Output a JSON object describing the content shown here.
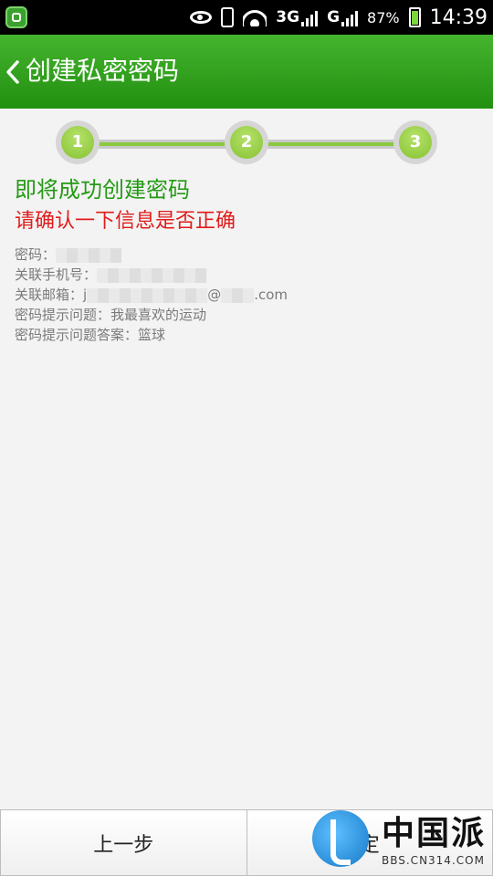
{
  "status_bar": {
    "network_3g": "3G",
    "network_g": "G",
    "battery_percent": "87%",
    "time": "14:39"
  },
  "header": {
    "title": "创建私密密码"
  },
  "stepper": {
    "steps": [
      "1",
      "2",
      "3"
    ],
    "active_color": "#8cc93f"
  },
  "content": {
    "title": "即将成功创建密码",
    "subtitle": "请确认一下信息是否正确",
    "rows": [
      {
        "label": "密码：",
        "value": ""
      },
      {
        "label": "关联手机号：",
        "value": ""
      },
      {
        "label": "关联邮箱：",
        "value": "j",
        "suffix": "@",
        "domain": "com"
      },
      {
        "label": "密码提示问题：",
        "value": "我最喜欢的运动"
      },
      {
        "label": "密码提示问题答案：",
        "value": "篮球"
      }
    ]
  },
  "bottom": {
    "prev_label": "上一步",
    "confirm_partial": "定"
  },
  "watermark": {
    "text": "中国派",
    "url": "BBS.CN314.COM"
  },
  "colors": {
    "header_green": "#2a9a17",
    "title_green": "#249a14",
    "warning_red": "#e11b1b"
  }
}
